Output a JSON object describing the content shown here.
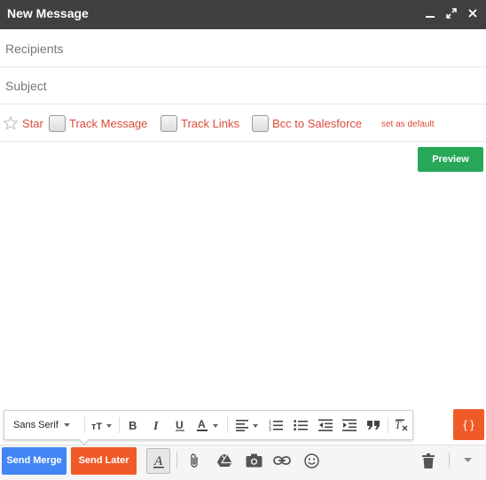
{
  "window": {
    "title": "New Message"
  },
  "fields": {
    "recipients_placeholder": "Recipients",
    "subject_placeholder": "Subject"
  },
  "options": {
    "star": "Star",
    "track_message": "Track Message",
    "track_links": "Track Links",
    "bcc_salesforce": "Bcc to Salesforce",
    "set_default": "set as default"
  },
  "preview_label": "Preview",
  "formatting": {
    "font": "Sans Serif"
  },
  "template_button": "{ }",
  "actions": {
    "send_merge": "Send Merge",
    "send_later": "Send Later"
  },
  "colors": {
    "titlebar": "#404040",
    "send_merge": "#4285f4",
    "send_later": "#f05a28",
    "preview": "#26a858",
    "option_text": "#dd4b39"
  },
  "icons": [
    "minimize-icon",
    "popout-icon",
    "close-icon",
    "star-icon",
    "text-size-icon",
    "bold-icon",
    "italic-icon",
    "underline-icon",
    "text-color-icon",
    "align-icon",
    "numbered-list-icon",
    "bulleted-list-icon",
    "indent-less-icon",
    "indent-more-icon",
    "quote-icon",
    "clear-formatting-icon",
    "formatting-options-icon",
    "attach-icon",
    "drive-icon",
    "photo-icon",
    "link-icon",
    "emoji-icon",
    "trash-icon",
    "more-options-icon"
  ]
}
